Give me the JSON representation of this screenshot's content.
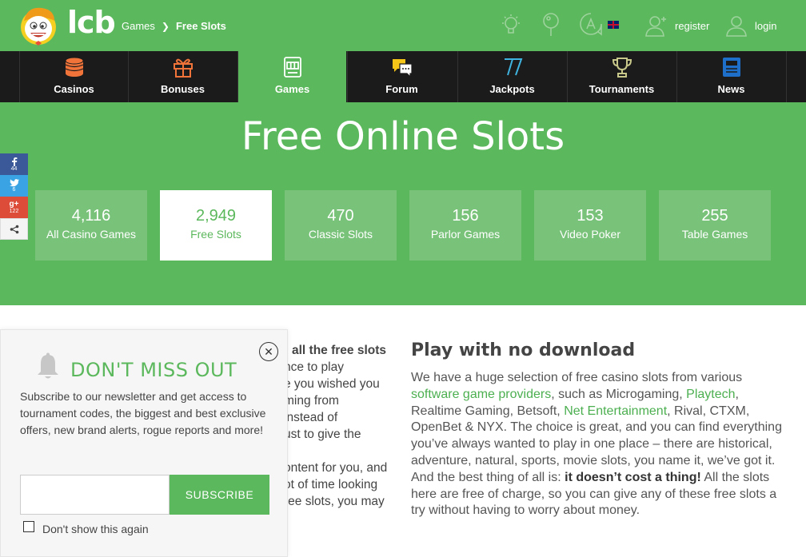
{
  "header": {
    "logo_text": "lcb",
    "breadcrumb": [
      "Games",
      "Free Slots"
    ],
    "register_label": "register",
    "login_label": "login",
    "icons": [
      "lightbulb-icon",
      "pin-icon",
      "language-icon",
      "flag-uk-icon"
    ]
  },
  "nav": {
    "items": [
      {
        "label": "Casinos",
        "icon": "chips-icon"
      },
      {
        "label": "Bonuses",
        "icon": "gift-icon"
      },
      {
        "label": "Games",
        "icon": "slot-machine-icon"
      },
      {
        "label": "Forum",
        "icon": "chat-icon"
      },
      {
        "label": "Jackpots",
        "icon": "seven-icon"
      },
      {
        "label": "Tournaments",
        "icon": "trophy-icon"
      },
      {
        "label": "News",
        "icon": "newspaper-icon"
      }
    ],
    "active": "Games"
  },
  "hero": {
    "title": "Free Online Slots",
    "stats": [
      {
        "num": "4,116",
        "label": "All Casino Games"
      },
      {
        "num": "2,949",
        "label": "Free Slots"
      },
      {
        "num": "470",
        "label": "Classic Slots"
      },
      {
        "num": "156",
        "label": "Parlor Games"
      },
      {
        "num": "153",
        "label": "Video Poker"
      },
      {
        "num": "255",
        "label": "Table Games"
      }
    ],
    "active_stat": "Free Slots"
  },
  "share": {
    "facebook_count": "44",
    "twitter_count": "6",
    "googleplus_count": "122"
  },
  "content": {
    "partial_lines": [
      "all the free slots",
      "nce to play",
      "e you wished you",
      "ming from",
      " instead of",
      "ust to give the",
      "",
      "ontent for you, and",
      "ot of time looking",
      "ree slots, you may"
    ],
    "heading": "Play with no download",
    "p_1": "We have a huge selection of free casino slots from various ",
    "link_1": "software game providers",
    "p_2": ", such as Microgaming, ",
    "link_2": "Playtech",
    "p_3": ", Realtime Gaming, Betsoft, ",
    "link_3": "Net Entertainment",
    "p_4": ", Rival, CTXM, OpenBet & NYX. The choice is great, and you can find everything you’ve always wanted to play in one place – there are historical, adventure, natural, sports, movie slots, you name it, we’ve got it. And the best thing of all is: ",
    "bold": "it doesn’t cost a thing!",
    "p_5": " All the slots here are free of charge, so you can give any of these free slots a try without having to worry about money."
  },
  "popup": {
    "title": "DON'T MISS OUT",
    "text": "Subscribe to our newsletter and get access to tournament codes, the biggest and best exclusive offers, new brand alerts, rogue reports and more!",
    "email_placeholder": "",
    "button": "SUBSCRIBE",
    "checkbox_label": "Don't show this again"
  },
  "colors": {
    "brand_green": "#5cb85c",
    "stat_tile": "#79c27a",
    "nav_bg": "#1b1b1b",
    "icon_orange": "#f0743a",
    "icon_blue": "#1e6fc9"
  }
}
